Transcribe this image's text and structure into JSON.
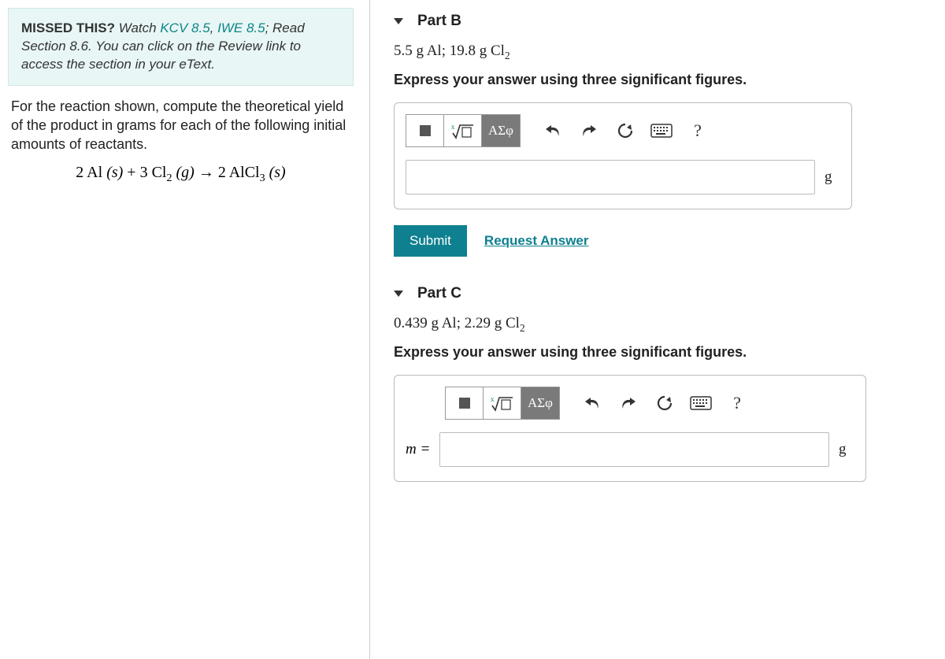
{
  "hint": {
    "bold": "MISSED THIS?",
    "watch": " Watch ",
    "kcv": "KCV 8.5",
    "comma": ", ",
    "iwe": "IWE 8.5",
    "rest": "; Read Section 8.6. You can click on the Review link to access the section in your eText."
  },
  "problem_text": "For the reaction shown, compute the theoretical yield of the product in grams for each of the following initial amounts of reactants.",
  "equation": {
    "lhs_coef1": "2 Al",
    "state_s1": "(s)",
    "plus": " + ",
    "lhs_coef2": "3 Cl",
    "cl2_sub": "2",
    "state_g": " (g) ",
    "arrow": "→",
    "rhs_coef": " 2 AlCl",
    "rhs_sub": "3",
    "state_s2": " (s)"
  },
  "partB": {
    "title": "Part B",
    "given_a": "5.5 g Al",
    "given_sep": "; ",
    "given_b": "19.8 g Cl",
    "given_sub": "2",
    "instr": "Express your answer using three significant figures.",
    "greek_label": "ΑΣφ",
    "unit": "g",
    "submit": "Submit",
    "request": "Request Answer",
    "help": "?"
  },
  "partC": {
    "title": "Part C",
    "given_a": "0.439 g Al",
    "given_sep": "; ",
    "given_b": "2.29 g Cl",
    "given_sub": "2",
    "instr": "Express your answer using three significant figures.",
    "greek_label": "ΑΣφ",
    "var_label": "m = ",
    "unit": "g",
    "help": "?"
  }
}
